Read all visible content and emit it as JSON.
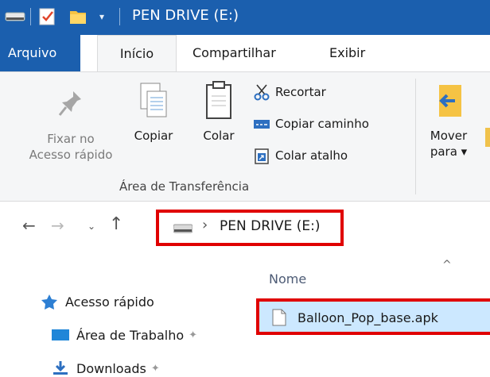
{
  "window": {
    "title": "PEN DRIVE (E:)",
    "accent_color": "#1b5fae",
    "highlight_color": "#e00000",
    "selection_color": "#cce8ff"
  },
  "quick_access_toolbar": {
    "icons": [
      "drive-icon",
      "properties-check-icon",
      "new-folder-icon",
      "customize-dropdown-icon"
    ]
  },
  "ribbon": {
    "tabs": [
      {
        "label": "Arquivo"
      },
      {
        "label": "Início"
      },
      {
        "label": "Compartilhar"
      },
      {
        "label": "Exibir"
      }
    ],
    "clipboard": {
      "pin_label_1": "Fixar no",
      "pin_label_2": "Acesso rápido",
      "copy_label": "Copiar",
      "paste_label": "Colar",
      "cut_label": "Recortar",
      "copy_path_label": "Copiar caminho",
      "paste_shortcut_label": "Colar atalho",
      "group_label": "Área de Transferência"
    },
    "organize": {
      "move_label_1": "Mover",
      "move_label_2": "para ▾"
    }
  },
  "address_bar": {
    "separator": "›",
    "location": "PEN DRIVE (E:)"
  },
  "navigation_pane": {
    "items": [
      {
        "label": "Acesso rápido",
        "icon": "star-icon"
      },
      {
        "label": "Área de Trabalho",
        "icon": "desktop-icon"
      },
      {
        "label": "Downloads",
        "icon": "downloads-icon"
      }
    ]
  },
  "file_list": {
    "column_header": "Nome",
    "files": [
      {
        "name": "Balloon_Pop_base.apk",
        "icon": "document-icon",
        "selected": true
      }
    ]
  }
}
